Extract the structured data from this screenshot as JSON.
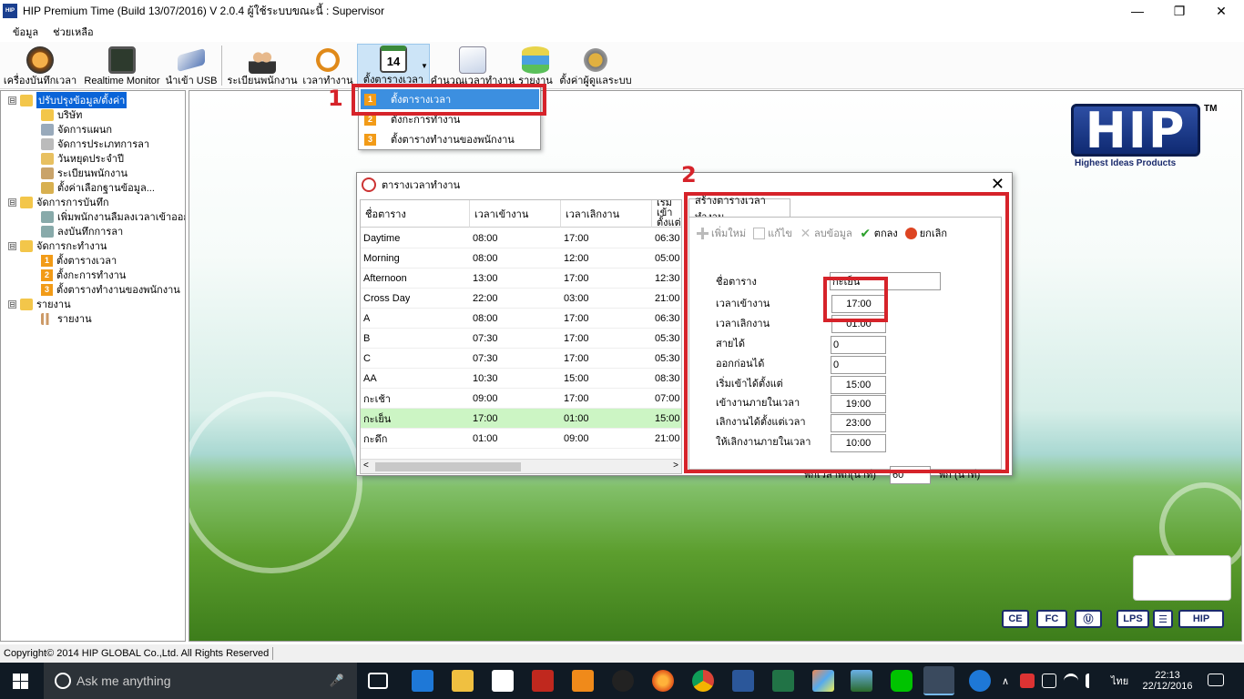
{
  "window": {
    "title": "HIP Premium Time (Build 13/07/2016) V 2.0.4   ผู้ใช้ระบบขณะนี้ : Supervisor",
    "controls": [
      "—",
      "❐",
      "✕"
    ]
  },
  "menubar": {
    "items": [
      "ข้อมูล",
      "ช่วยเหลือ"
    ]
  },
  "toolbar": {
    "items": [
      {
        "label": "เครื่องบันทึกเวลา",
        "icon": "alarm-clock-icon"
      },
      {
        "label": "Realtime Monitor",
        "icon": "monitor-icon"
      },
      {
        "label": "นำเข้า USB",
        "icon": "usb-icon"
      },
      {
        "label": "ระเบียนพนักงาน",
        "icon": "employees-icon"
      },
      {
        "label": "เวลาทำงาน",
        "icon": "stopwatch-icon"
      },
      {
        "label": "ตั้งตารางเวลา",
        "icon": "calendar-icon",
        "calendar_number": "14"
      },
      {
        "label": "คำนวณเวลาทำงาน",
        "icon": "calculate-icon"
      },
      {
        "label": "รายงาน",
        "icon": "report-icon"
      },
      {
        "label": "ตั้งค่าผู้ดูแลระบบ",
        "icon": "admin-settings-icon"
      }
    ]
  },
  "tree": {
    "nodes": [
      {
        "label": "ปรับปรุงข้อมูล/ตั้งค่า",
        "expander": "⊟",
        "selected": true
      },
      {
        "label": "บริษัท"
      },
      {
        "label": "จัดการแผนก"
      },
      {
        "label": "จัดการประเภทการลา"
      },
      {
        "label": "วันหยุดประจำปี"
      },
      {
        "label": "ระเบียนพนักงาน"
      },
      {
        "label": "ตั้งค่าเลือกฐานข้อมูล..."
      },
      {
        "label": "จัดการการบันทึก",
        "expander": "⊟"
      },
      {
        "label": "เพิ่มพนักงานลืมลงเวลาเข้าออก"
      },
      {
        "label": "ลงบันทึกการลา"
      },
      {
        "label": "จัดการกะทำงาน",
        "expander": "⊟"
      },
      {
        "label": "ตั้งตารางเวลา",
        "num": "1"
      },
      {
        "label": "ตั้งกะการทำงาน",
        "num": "2"
      },
      {
        "label": "ตั้งตารางทำงานของพนักงาน",
        "num": "3"
      },
      {
        "label": "รายงาน",
        "expander": "⊟"
      },
      {
        "label": "รายงาน"
      }
    ]
  },
  "dropdown": {
    "items": [
      {
        "num": "1",
        "label": "ตั้งตารางเวลา"
      },
      {
        "num": "2",
        "label": "ตั้งกะการทำงาน"
      },
      {
        "num": "3",
        "label": "ตั้งตารางทำงานของพนักงาน"
      }
    ]
  },
  "annotations": {
    "label1": "1",
    "label2": "2"
  },
  "logo": {
    "text": "HIP",
    "tm": "TM",
    "subtitle": "Highest Ideas Products"
  },
  "certs": [
    "CE",
    "FC",
    "Ⓤ",
    "LPS",
    "☰",
    "HIP"
  ],
  "dialog": {
    "title": "ตารางเวลาทำงาน",
    "close": "✕",
    "grid": {
      "columns": [
        "ชื่อตาราง",
        "เวลาเข้างาน",
        "เวลาเลิกงาน",
        "เริ่มเข้า ตั้งแต่"
      ],
      "rows": [
        [
          "Daytime",
          "08:00",
          "17:00",
          "06:30"
        ],
        [
          "Morning",
          "08:00",
          "12:00",
          "05:00"
        ],
        [
          "Afternoon",
          "13:00",
          "17:00",
          "12:30"
        ],
        [
          "Cross Day",
          "22:00",
          "03:00",
          "21:00"
        ],
        [
          "A",
          "08:00",
          "17:00",
          "06:30"
        ],
        [
          "B",
          "07:30",
          "17:00",
          "05:30"
        ],
        [
          "C",
          "07:30",
          "17:00",
          "05:30"
        ],
        [
          "AA",
          "10:30",
          "15:00",
          "08:30"
        ],
        [
          "กะเช้า",
          "09:00",
          "17:00",
          "07:00"
        ],
        [
          "กะเย็น",
          "17:00",
          "01:00",
          "15:00"
        ],
        [
          "กะดึก",
          "01:00",
          "09:00",
          "21:00"
        ]
      ],
      "selected_row": 9,
      "scroll_left": "<",
      "scroll_right": ">"
    },
    "panel": {
      "tab": "สร้างตารางเวลาทำงาน",
      "tools": [
        {
          "label": "เพิ่มใหม่",
          "icon": "plus-icon",
          "enabled": false
        },
        {
          "label": "แก้ไข",
          "icon": "edit-icon",
          "enabled": false
        },
        {
          "label": "ลบข้อมูล",
          "icon": "delete-icon",
          "enabled": false
        },
        {
          "label": "ตกลง",
          "icon": "check-icon",
          "enabled": true
        },
        {
          "label": "ยกเลิก",
          "icon": "cancel-icon",
          "enabled": true
        }
      ],
      "fields": [
        {
          "label": "ชื่อตาราง",
          "value": "กะเย็น"
        },
        {
          "label": "เวลาเข้างาน",
          "value": "17:00"
        },
        {
          "label": "เวลาเลิกงาน",
          "value": "01:00"
        },
        {
          "label": "สายได้",
          "value": "0"
        },
        {
          "label": "ออกก่อนได้",
          "value": "0"
        },
        {
          "label": "เริ่มเข้าได้ตั้งแต่",
          "value": "15:00"
        },
        {
          "label": "เข้างานภายในเวลา",
          "value": "19:00"
        },
        {
          "label": "เลิกงานได้ตั้งแต่เวลา",
          "value": "23:00"
        },
        {
          "label": "ให้เลิกงานภายในเวลา",
          "value": "10:00"
        }
      ],
      "break_label": "พักเวลาพัก(นาที)",
      "break_value": "60",
      "break_unit": "พัก (นาที)"
    }
  },
  "statusbar": {
    "text": "Copyright© 2014 HIP GLOBAL Co.,Ltd. All Rights Reserved"
  },
  "taskbar": {
    "search_placeholder": "Ask me anything",
    "mic": "🎤",
    "tray_language": "ไทย",
    "time": "22:13",
    "date": "22/12/2016",
    "tray_chevron": "∧"
  },
  "colors": {
    "accent_red": "#d6232a",
    "selected_row": "#ccf5c4",
    "menu_highlight": "#3c8fe0"
  }
}
